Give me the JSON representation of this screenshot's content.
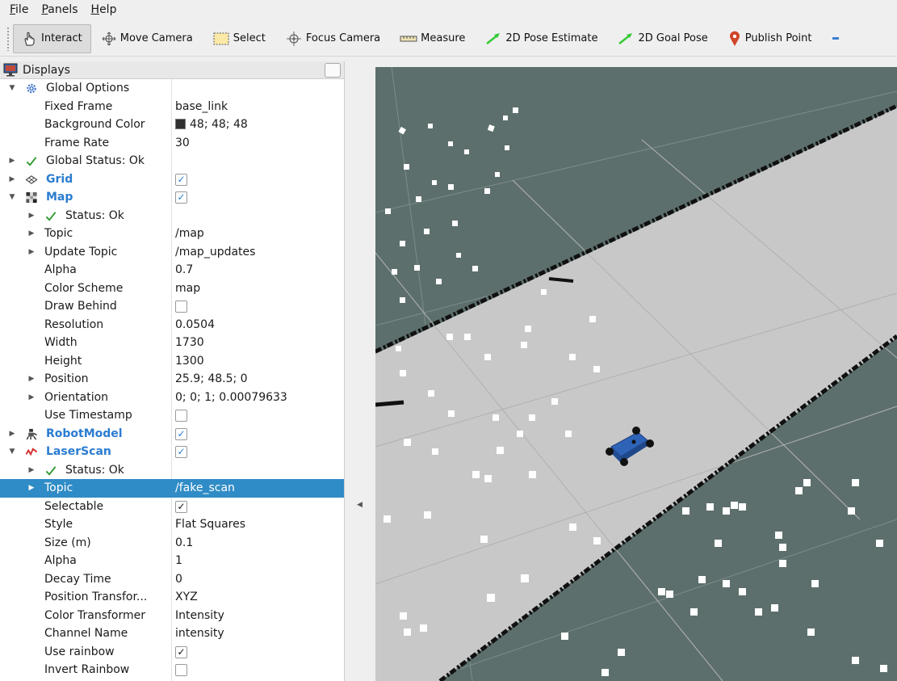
{
  "menubar": {
    "items": [
      {
        "label": "File",
        "mnemonic": "F",
        "rest": "ile"
      },
      {
        "label": "Panels",
        "mnemonic": "P",
        "rest": "anels"
      },
      {
        "label": "Help",
        "mnemonic": "H",
        "rest": "elp"
      }
    ]
  },
  "toolbar": {
    "interact": "Interact",
    "move_camera": "Move Camera",
    "select": "Select",
    "focus_camera": "Focus Camera",
    "measure": "Measure",
    "pose_estimate": "2D Pose Estimate",
    "goal_pose": "2D Goal Pose",
    "publish_point": "Publish Point"
  },
  "displays": {
    "title": "Displays",
    "global_options": {
      "label": "Global Options",
      "fixed_frame_label": "Fixed Frame",
      "fixed_frame": "base_link",
      "bg_color_label": "Background Color",
      "bg_color": "48; 48; 48",
      "frame_rate_label": "Frame Rate",
      "frame_rate": "30"
    },
    "global_status": "Global Status: Ok",
    "grid": {
      "label": "Grid",
      "enabled": true
    },
    "map": {
      "label": "Map",
      "enabled": true,
      "status": "Status: Ok",
      "topic_label": "Topic",
      "topic": "/map",
      "update_topic_label": "Update Topic",
      "update_topic": "/map_updates",
      "alpha_label": "Alpha",
      "alpha": "0.7",
      "color_scheme_label": "Color Scheme",
      "color_scheme": "map",
      "draw_behind_label": "Draw Behind",
      "draw_behind": false,
      "resolution_label": "Resolution",
      "resolution": "0.0504",
      "width_label": "Width",
      "width": "1730",
      "height_label": "Height",
      "height": "1300",
      "position_label": "Position",
      "position": "25.9; 48.5; 0",
      "orientation_label": "Orientation",
      "orientation": "0; 0; 1; 0.00079633",
      "use_timestamp_label": "Use Timestamp",
      "use_timestamp": false
    },
    "robot_model": {
      "label": "RobotModel",
      "enabled": true
    },
    "laser_scan": {
      "label": "LaserScan",
      "enabled": true,
      "status": "Status: Ok",
      "topic_label": "Topic",
      "topic": "/fake_scan",
      "selectable_label": "Selectable",
      "selectable": true,
      "style_label": "Style",
      "style": "Flat Squares",
      "size_label": "Size (m)",
      "size": "0.1",
      "alpha_label": "Alpha",
      "alpha": "1",
      "decay_label": "Decay Time",
      "decay": "0",
      "pos_transformer_label": "Position Transfor...",
      "pos_transformer": "XYZ",
      "color_transformer_label": "Color Transformer",
      "color_transformer": "Intensity",
      "channel_label": "Channel Name",
      "channel": "intensity",
      "use_rainbow_label": "Use rainbow",
      "use_rainbow": true,
      "invert_rainbow_label": "Invert Rainbow",
      "invert_rainbow": false
    }
  },
  "colors": {
    "selection": "#308cc6",
    "background_3d": "#5d6f6d",
    "map_free": "#c8c8c8",
    "robot": "#2f63b8"
  },
  "checkmark": "✓"
}
